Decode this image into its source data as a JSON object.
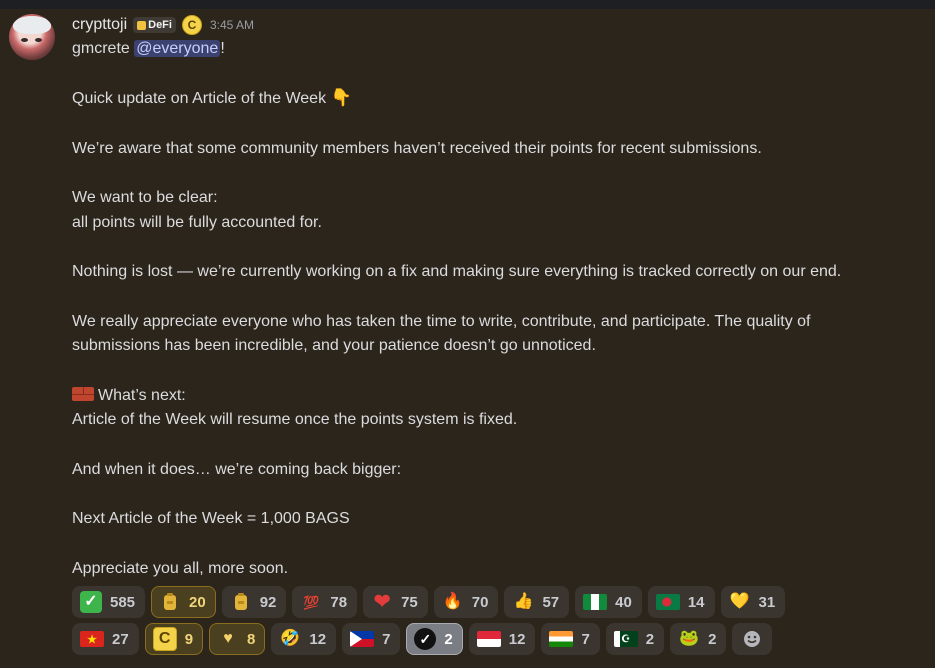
{
  "message": {
    "username": "crypttoji",
    "role_tag": "DeFi",
    "badge_letter": "C",
    "timestamp": "3:45 AM",
    "greeting": "gmcrete ",
    "mention": "@everyone",
    "greeting_end": "!",
    "title": "Quick update on Article of the Week ",
    "title_emoji": "👇",
    "p1": "We’re aware that some community members haven’t received their points for recent submissions.",
    "p2a": "We want to be clear:",
    "p2b": "all points will be fully accounted for.",
    "p3": "Nothing is lost — we’re currently working on a fix and making sure everything is tracked correctly on our end.",
    "p4a": "We really appreciate everyone who has taken the time to write, contribute, and participate. The quality of",
    "p4b": "submissions has been incredible, and your patience doesn’t go unnoticed.",
    "next_heading": "What’s next:",
    "next_line": "Article of the Week will resume once the points system is fixed.",
    "p6": "And when it does… we’re coming back bigger:",
    "p7": "Next Article of the Week = 1,000 BAGS",
    "p8": "Appreciate you all, more soon."
  },
  "reactions": {
    "row1": [
      {
        "icon": "check-box-icon",
        "glyph": "✓",
        "count": "585"
      },
      {
        "icon": "gold-bag-icon",
        "glyph": "",
        "count": "20"
      },
      {
        "icon": "gold-bag-icon",
        "glyph": "",
        "count": "92"
      },
      {
        "icon": "hundred-points-icon",
        "glyph": "💯",
        "count": "78"
      },
      {
        "icon": "red-heart-icon",
        "glyph": "❤",
        "count": "75"
      },
      {
        "icon": "fire-icon",
        "glyph": "🔥",
        "count": "70"
      },
      {
        "icon": "thumbs-up-icon",
        "glyph": "👍",
        "count": "57"
      },
      {
        "icon": "nigeria-flag-icon",
        "glyph": "",
        "count": "40"
      },
      {
        "icon": "bangladesh-flag-icon",
        "glyph": "",
        "count": "14"
      },
      {
        "icon": "yellow-heart-icon",
        "glyph": "💛",
        "count": "31"
      }
    ],
    "row2": [
      {
        "icon": "vietnam-flag-icon",
        "glyph": "",
        "count": "27"
      },
      {
        "icon": "c-coin-icon",
        "glyph": "C",
        "count": "9"
      },
      {
        "icon": "heart-hands-icon",
        "glyph": "♥",
        "count": "8"
      },
      {
        "icon": "rofl-icon",
        "glyph": "🤣",
        "count": "12"
      },
      {
        "icon": "philippines-flag-icon",
        "glyph": "",
        "count": "7"
      },
      {
        "icon": "verified-check-icon",
        "glyph": "✓",
        "count": "2"
      },
      {
        "icon": "indonesia-flag-icon",
        "glyph": "",
        "count": "12"
      },
      {
        "icon": "india-flag-icon",
        "glyph": "",
        "count": "7"
      },
      {
        "icon": "pakistan-flag-icon",
        "glyph": "",
        "count": "2"
      },
      {
        "icon": "frog-icon",
        "glyph": "🐸",
        "count": "2"
      }
    ]
  },
  "colors": {
    "background": "#2b251c",
    "mention_bg": "#3c4270",
    "mention_text": "#c9cdfb",
    "reaction_bg": "#3a352e",
    "reaction_selected_bg": "#4a3f1e"
  }
}
